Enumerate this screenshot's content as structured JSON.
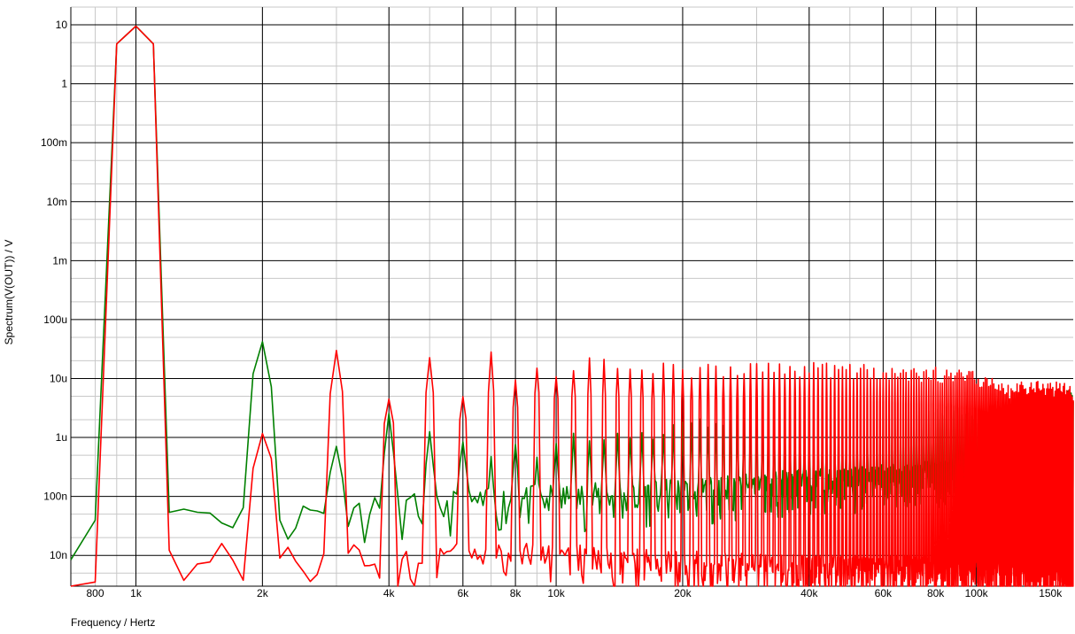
{
  "chart_data": {
    "type": "line",
    "xlabel": "Frequency / Hertz",
    "ylabel": "Spectrum(V(OUT)) / V",
    "x_scale": "log",
    "y_scale": "log",
    "xlim": [
      700,
      170000
    ],
    "ylim": [
      3e-09,
      20
    ],
    "grid": true,
    "x_ticks": [
      {
        "value": 800,
        "label": "800"
      },
      {
        "value": 1000,
        "label": "1k"
      },
      {
        "value": 2000,
        "label": "2k"
      },
      {
        "value": 4000,
        "label": "4k"
      },
      {
        "value": 6000,
        "label": "6k"
      },
      {
        "value": 8000,
        "label": "8k"
      },
      {
        "value": 10000,
        "label": "10k"
      },
      {
        "value": 20000,
        "label": "20k"
      },
      {
        "value": 40000,
        "label": "40k"
      },
      {
        "value": 60000,
        "label": "60k"
      },
      {
        "value": 80000,
        "label": "80k"
      },
      {
        "value": 100000,
        "label": "100k"
      },
      {
        "value": 150000,
        "label": "150k"
      }
    ],
    "y_ticks": [
      {
        "value": 10,
        "label": "10"
      },
      {
        "value": 1,
        "label": "1"
      },
      {
        "value": 0.1,
        "label": "100m"
      },
      {
        "value": 0.01,
        "label": "10m"
      },
      {
        "value": 0.001,
        "label": "1m"
      },
      {
        "value": 0.0001,
        "label": "100u"
      },
      {
        "value": 1e-05,
        "label": "10u"
      },
      {
        "value": 1e-06,
        "label": "1u"
      },
      {
        "value": 1e-07,
        "label": "100n"
      },
      {
        "value": 1e-08,
        "label": "10n"
      }
    ],
    "series": [
      {
        "color": "#008000",
        "fundamental": {
          "freq": 1000,
          "peak": 9.5
        },
        "noise_floor": [
          [
            700,
            2.8e-08
          ],
          [
            1000,
            6e-08
          ],
          [
            2000,
            4e-08
          ],
          [
            5000,
            6e-08
          ],
          [
            10000,
            8e-08
          ],
          [
            20000,
            1e-07
          ],
          [
            40000,
            1.5e-07
          ],
          [
            80000,
            2e-07
          ],
          [
            170000,
            2e-07
          ]
        ],
        "harmonics": [
          [
            2000,
            4e-05
          ],
          [
            3000,
            6e-07
          ],
          [
            4000,
            2e-06
          ],
          [
            5000,
            1.1e-06
          ],
          [
            6000,
            1.2e-06
          ],
          [
            7000,
            4e-07
          ],
          [
            8000,
            1e-06
          ],
          [
            9000,
            5e-07
          ],
          [
            10000,
            1e-06
          ],
          [
            12000,
            1e-06
          ],
          [
            15000,
            1.2e-06
          ],
          [
            20000,
            1.5e-06
          ],
          [
            30000,
            2e-06
          ],
          [
            40000,
            1.5e-06
          ],
          [
            50000,
            1.5e-06
          ],
          [
            60000,
            2e-06
          ],
          [
            70000,
            2.5e-06
          ],
          [
            80000,
            2.8e-06
          ],
          [
            90000,
            3e-06
          ],
          [
            100000,
            2.5e-06
          ],
          [
            110000,
            1e-06
          ],
          [
            120000,
            3e-07
          ],
          [
            130000,
            1.5e-06
          ],
          [
            140000,
            3e-06
          ],
          [
            150000,
            4e-06
          ],
          [
            160000,
            5e-06
          ],
          [
            170000,
            5.5e-06
          ]
        ]
      },
      {
        "color": "#ff0000",
        "fundamental": {
          "freq": 1000,
          "peak": 9.5
        },
        "noise_floor": [
          [
            700,
            4e-09
          ],
          [
            1000,
            9e-09
          ],
          [
            2000,
            8e-09
          ],
          [
            5000,
            8e-09
          ],
          [
            10000,
            8e-09
          ],
          [
            20000,
            6e-09
          ],
          [
            40000,
            5e-09
          ],
          [
            80000,
            5e-09
          ],
          [
            170000,
            5e-09
          ]
        ],
        "harmonics": [
          [
            2000,
            1e-06
          ],
          [
            3000,
            2.4e-05
          ],
          [
            4000,
            5e-06
          ],
          [
            5000,
            2.2e-05
          ],
          [
            6000,
            6e-06
          ],
          [
            7000,
            2.2e-05
          ],
          [
            8000,
            1e-05
          ],
          [
            9000,
            2e-05
          ],
          [
            10000,
            1.5e-05
          ],
          [
            12000,
            1.8e-05
          ],
          [
            15000,
            1.6e-05
          ],
          [
            20000,
            1.4e-05
          ],
          [
            30000,
            1.5e-05
          ],
          [
            40000,
            1.5e-05
          ],
          [
            50000,
            1.4e-05
          ],
          [
            60000,
            1.3e-05
          ],
          [
            70000,
            1.2e-05
          ],
          [
            80000,
            1.2e-05
          ],
          [
            90000,
            1.1e-05
          ],
          [
            100000,
            1e-05
          ],
          [
            110000,
            8e-06
          ],
          [
            120000,
            6e-06
          ],
          [
            130000,
            7e-06
          ],
          [
            150000,
            7e-06
          ],
          [
            170000,
            6e-06
          ]
        ]
      }
    ]
  }
}
